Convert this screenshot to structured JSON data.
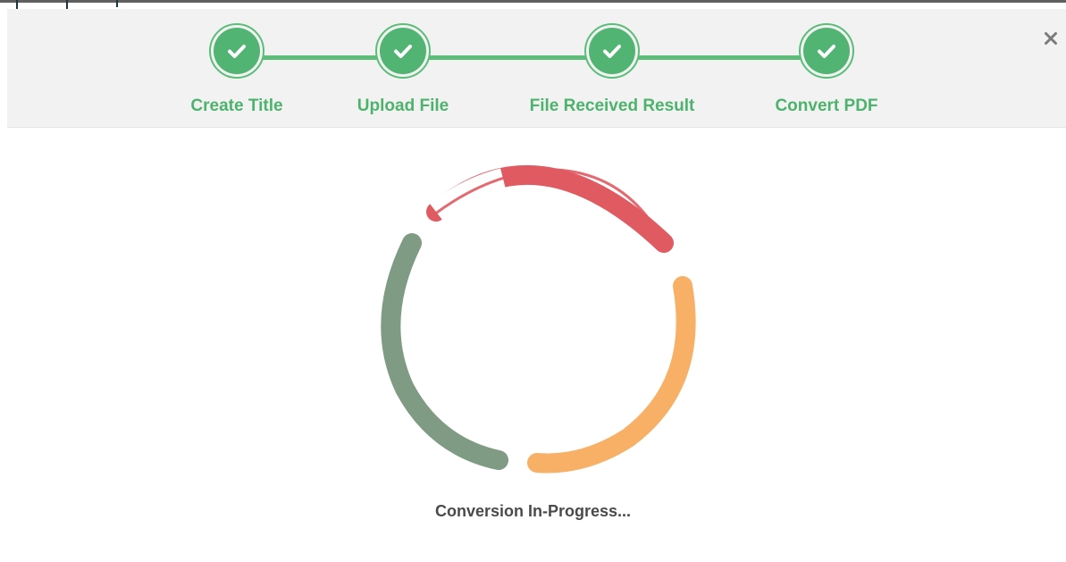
{
  "stepper": {
    "steps": [
      {
        "label": "Create Title",
        "icon": "check-icon",
        "status": "completed"
      },
      {
        "label": "Upload File",
        "icon": "check-icon",
        "status": "completed"
      },
      {
        "label": "File Received Result",
        "icon": "check-icon",
        "status": "completed"
      },
      {
        "label": "Convert PDF",
        "icon": "check-icon",
        "status": "completed"
      }
    ],
    "accent_color": "#5bbd78"
  },
  "close_icon": "close-icon",
  "spinner": {
    "icon": "loading-spinner",
    "colors": [
      "#e05a62",
      "#f7b066",
      "#7f9b84"
    ]
  },
  "status": {
    "text": "Conversion In-Progress..."
  }
}
